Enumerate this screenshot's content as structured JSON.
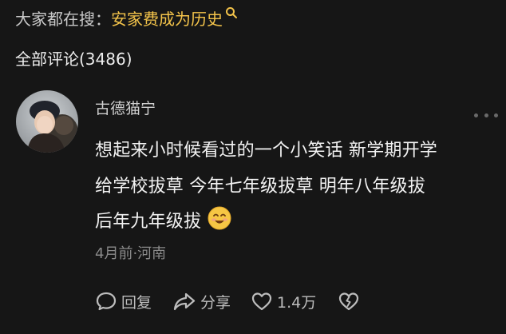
{
  "search": {
    "prefix": "大家都在搜：",
    "term": "安家费成为历史",
    "icon": "search-icon"
  },
  "comments": {
    "header": "全部评论(3486)"
  },
  "comment": {
    "username": "古德猫宁",
    "lines": [
      "想起来小时候看过的一个小笑话 新学期开学",
      "给学校拔草 今年七年级拔草 明年八年级拔",
      "后年九年级拔"
    ],
    "emoji": "smile-emoji-icon",
    "meta": "4月前·河南",
    "actions": {
      "reply": "回复",
      "share": "分享",
      "likes": "1.4万"
    }
  },
  "colors": {
    "background": "#161616",
    "accent": "#f3c34a",
    "text": "#f2f2f2",
    "muted": "#8a8a8a"
  }
}
